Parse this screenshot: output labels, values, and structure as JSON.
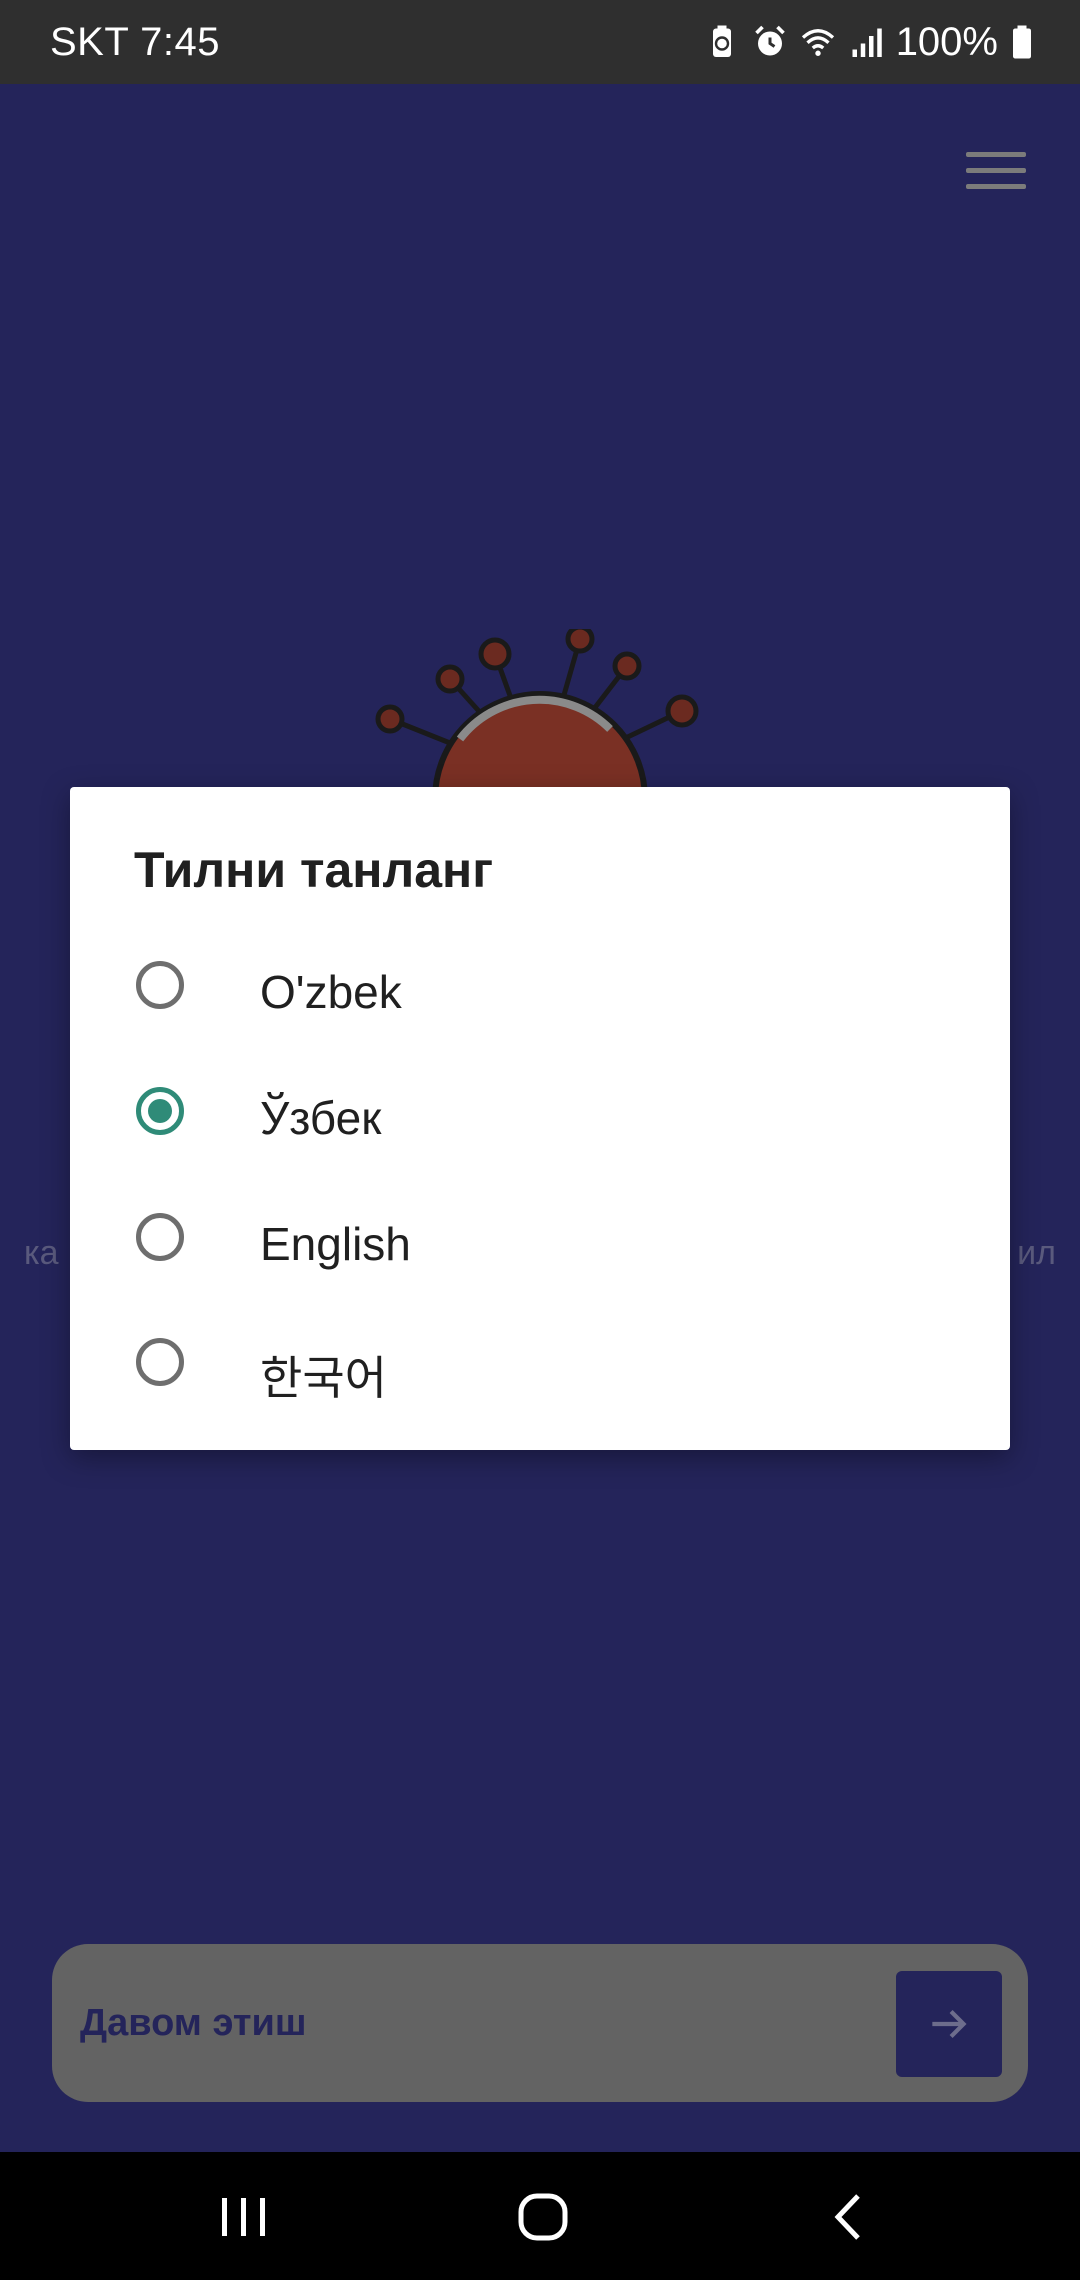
{
  "status_bar": {
    "carrier_time": "SKT 7:45",
    "battery_percent": "100%",
    "icons": [
      "battery-saver-icon",
      "alarm-icon",
      "wifi-icon",
      "signal-icon",
      "battery-icon"
    ]
  },
  "app": {
    "background_color": "#24245a",
    "side_text_left": "ка",
    "side_text_right": "ил",
    "continue_button": {
      "label": "Давом этиш",
      "icon": "arrow-right-icon"
    },
    "menu_icon": "hamburger-menu-icon",
    "illustration": "virus-illustration"
  },
  "dialog": {
    "title": "Тилни танланг",
    "options": [
      {
        "label": "O'zbek",
        "checked": false
      },
      {
        "label": "Ўзбек",
        "checked": true
      },
      {
        "label": "English",
        "checked": false
      },
      {
        "label": "한국어",
        "checked": false
      }
    ],
    "accent_color": "#2f8b78"
  },
  "nav_bar": {
    "icons": [
      "recent-apps-icon",
      "home-icon",
      "back-icon"
    ]
  }
}
